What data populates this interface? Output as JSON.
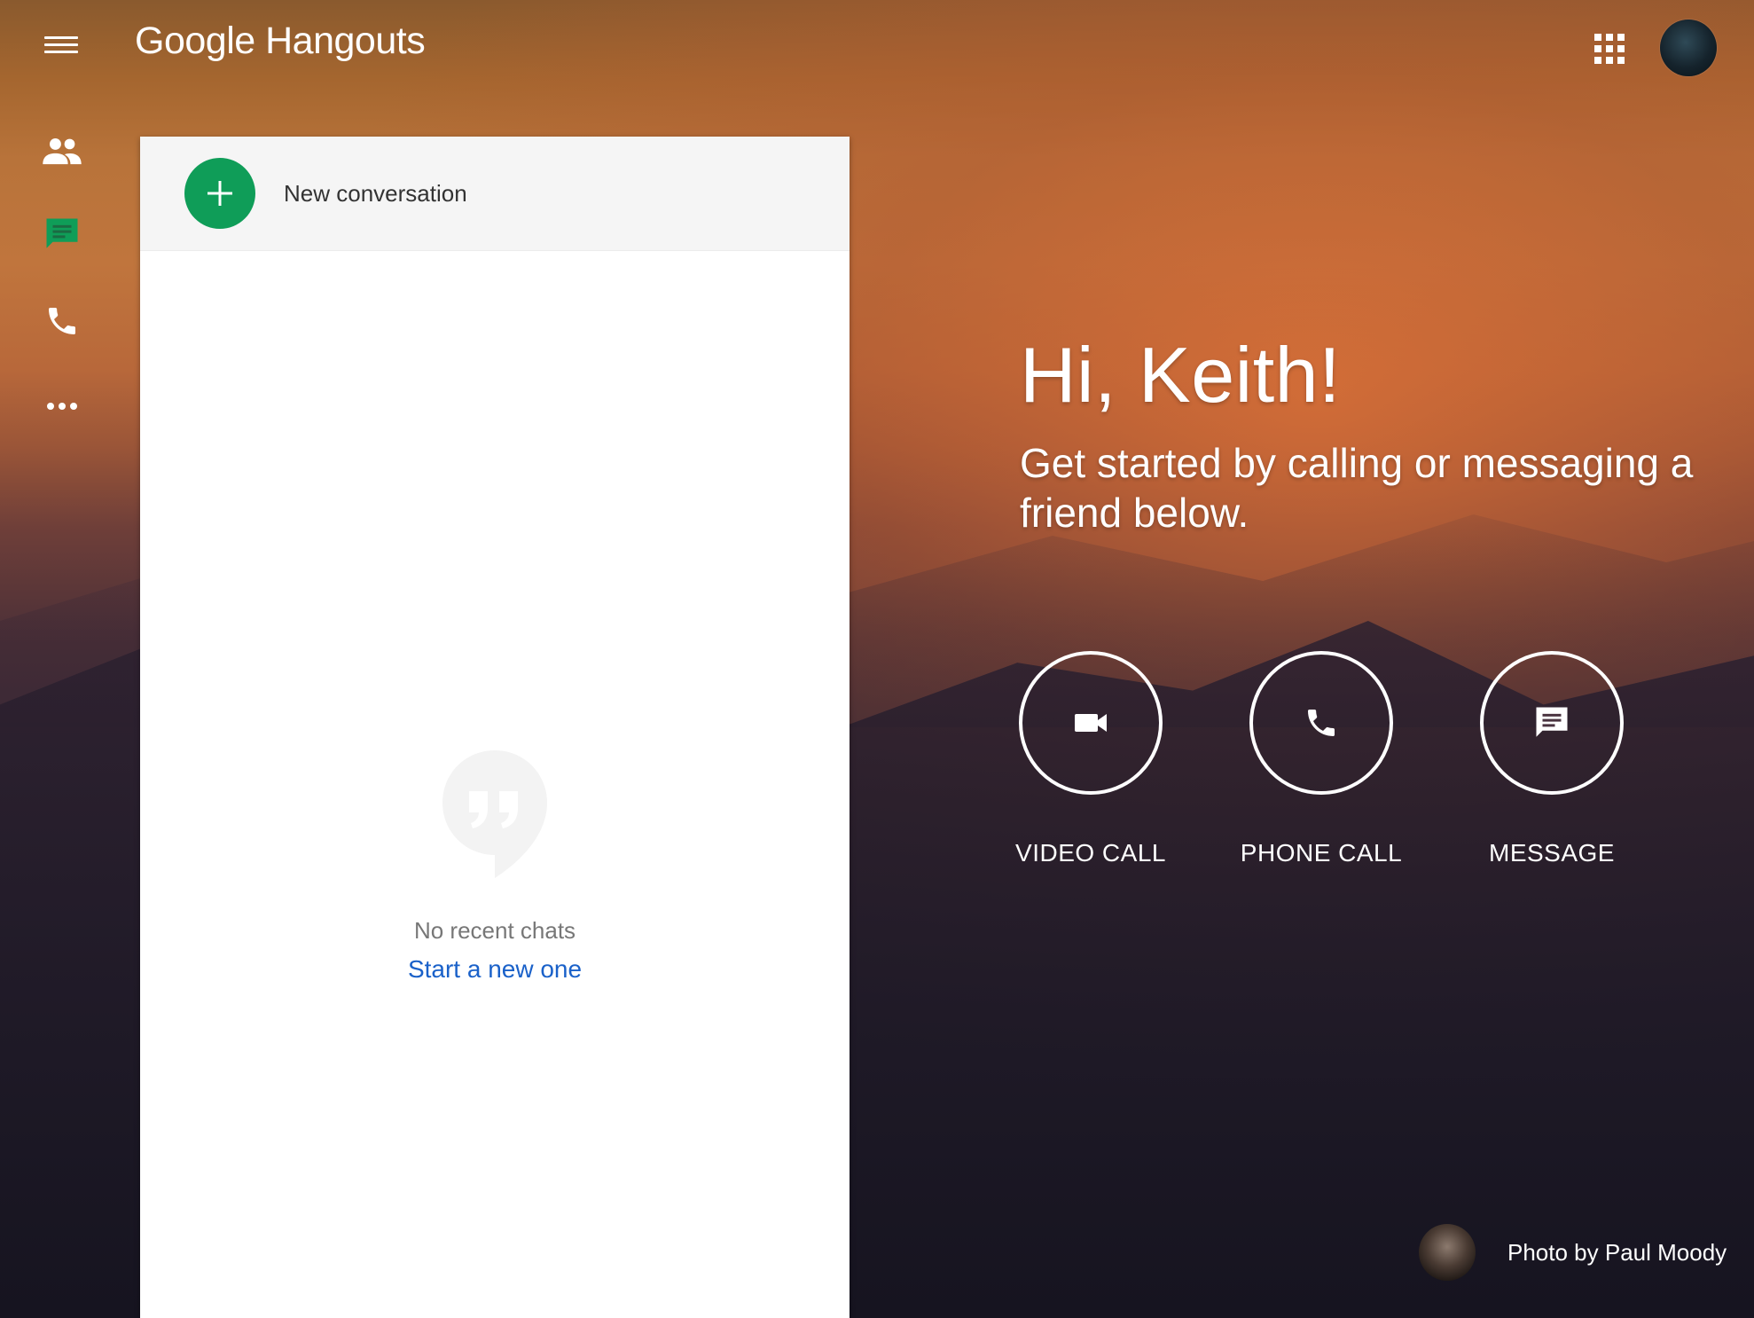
{
  "app": {
    "title_google": "Google",
    "title_product": "Hangouts"
  },
  "icons": {
    "menu": "menu-icon",
    "apps": "apps-grid-icon",
    "contacts": "contacts-icon",
    "conversations": "chat-icon",
    "phone": "phone-icon",
    "more": "more-icon"
  },
  "colors": {
    "active_green": "#0f9d58",
    "link_blue": "#1a61c9"
  },
  "panel": {
    "new_conversation_label": "New conversation",
    "empty_title": "No recent chats",
    "empty_link": "Start a new one"
  },
  "greeting": {
    "title": "Hi, Keith!",
    "subtitle": "Get started by calling or messaging a friend below."
  },
  "actions": [
    {
      "label": "VIDEO CALL",
      "icon": "video-camera-icon"
    },
    {
      "label": "PHONE CALL",
      "icon": "phone-icon"
    },
    {
      "label": "MESSAGE",
      "icon": "message-icon"
    }
  ],
  "credit": {
    "text": "Photo by Paul Moody"
  }
}
